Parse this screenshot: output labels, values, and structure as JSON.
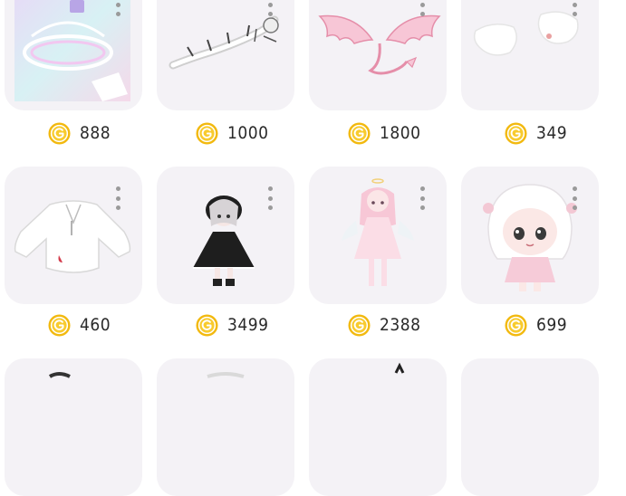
{
  "items": [
    {
      "price": "888",
      "icon": "coin-icon",
      "art": "rainbow-halo-accessory"
    },
    {
      "price": "1000",
      "icon": "coin-icon",
      "art": "white-dragon-accessory"
    },
    {
      "price": "1800",
      "icon": "coin-icon",
      "art": "pink-devil-wings"
    },
    {
      "price": "349",
      "icon": "coin-icon",
      "art": "white-fluffy-tails"
    },
    {
      "price": "460",
      "icon": "coin-icon",
      "art": "white-sweater-top"
    },
    {
      "price": "3499",
      "icon": "coin-icon",
      "art": "black-lolita-outfit"
    },
    {
      "price": "2388",
      "icon": "coin-icon",
      "art": "pink-angel-outfit"
    },
    {
      "price": "699",
      "icon": "coin-icon",
      "art": "white-haired-chibi-avatar"
    }
  ],
  "colors": {
    "coin": "#f2b90f",
    "card_bg": "#f4f2f6",
    "price_text": "#2a2a2a",
    "dots": "#9a9a9a"
  }
}
